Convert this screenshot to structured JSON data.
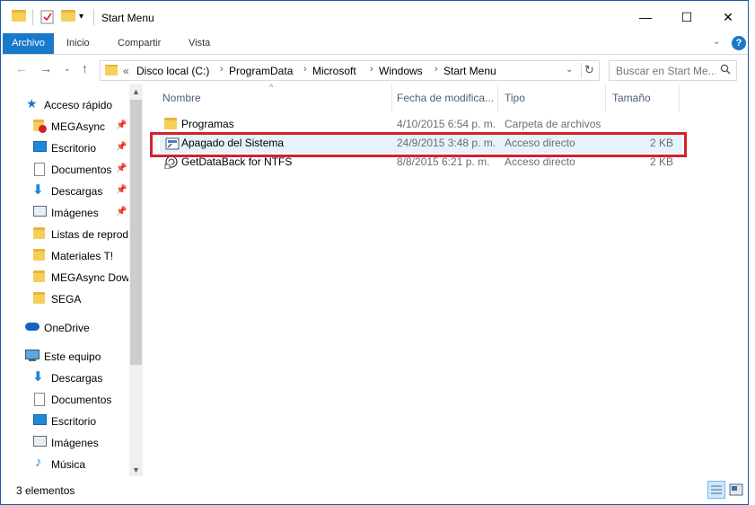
{
  "window": {
    "title": "Start Menu",
    "minimize": "—",
    "maximize": "☐",
    "close": "✕"
  },
  "ribbon": {
    "tabs": [
      "Archivo",
      "Inicio",
      "Compartir",
      "Vista"
    ],
    "help": "?"
  },
  "address": {
    "prefix": "«",
    "crumbs": [
      "Disco local (C:)",
      "ProgramData",
      "Microsoft",
      "Windows",
      "Start Menu"
    ]
  },
  "search": {
    "placeholder": "Buscar en Start Me..."
  },
  "navpane": {
    "quick_access": "Acceso rápido",
    "quick_items": [
      "MEGAsync",
      "Escritorio",
      "Documentos",
      "Descargas",
      "Imágenes",
      "Listas de reprodu",
      "Materiales T!",
      "MEGAsync Down",
      "SEGA"
    ],
    "onedrive": "OneDrive",
    "this_pc": "Este equipo",
    "pc_items": [
      "Descargas",
      "Documentos",
      "Escritorio",
      "Imágenes",
      "Música"
    ]
  },
  "columns": {
    "name": "Nombre",
    "date": "Fecha de modifica...",
    "type": "Tipo",
    "size": "Tamaño"
  },
  "files": [
    {
      "name": "Programas",
      "date": "4/10/2015 6:54 p. m.",
      "type": "Carpeta de archivos",
      "size": "",
      "icon": "folder-icon"
    },
    {
      "name": "Apagado del Sistema",
      "date": "24/9/2015 3:48 p. m.",
      "type": "Acceso directo",
      "size": "2 KB",
      "icon": "shortcut-icon"
    },
    {
      "name": "GetDataBack for NTFS",
      "date": "8/8/2015 6:21 p. m.",
      "type": "Acceso directo",
      "size": "2 KB",
      "icon": "app-shortcut-icon"
    }
  ],
  "status": {
    "count": "3 elementos"
  },
  "colors": {
    "accent": "#1979ca",
    "highlight": "#d3212d",
    "selection": "#e5f3fb"
  }
}
